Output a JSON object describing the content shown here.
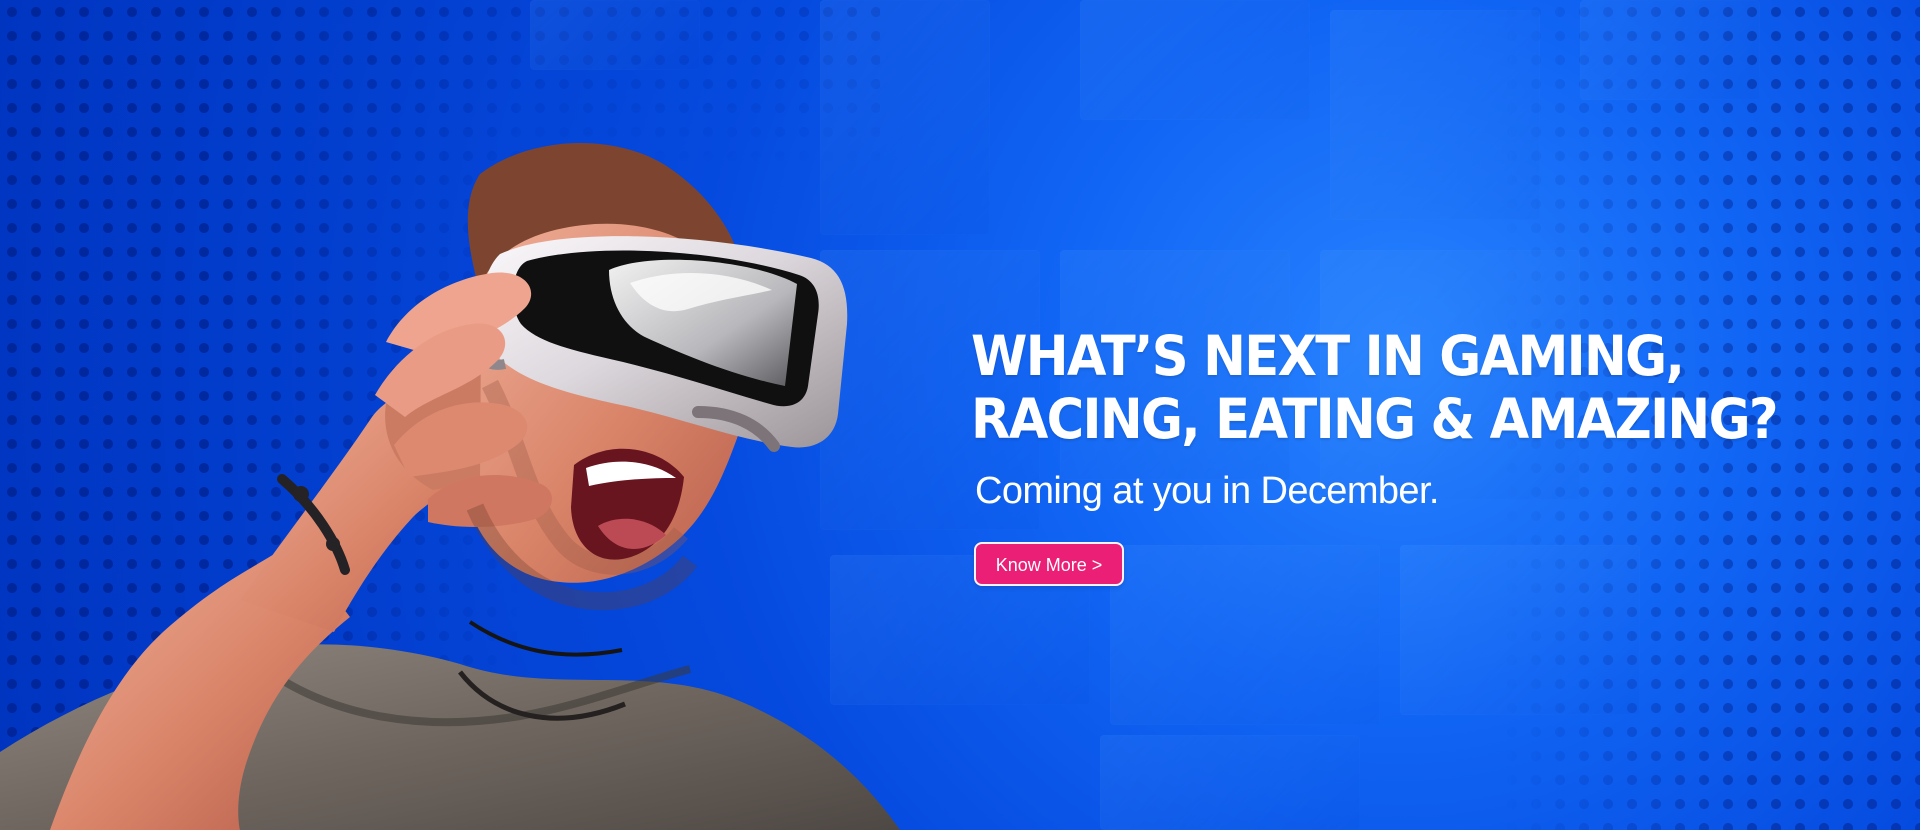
{
  "banner": {
    "headline_line_1": "WHAT’S NEXT IN GAMING,",
    "headline_line_2": "RACING, EATING & AMAZING?",
    "subheadline": "Coming at you in December.",
    "cta_label": "Know More >"
  },
  "colors": {
    "background_blue": "#0b5be7",
    "cta_pink": "#ea1f75",
    "text_white": "#ffffff",
    "shirt_gray": "#6f665f",
    "headset_white": "#ddd8dd",
    "skin_tone": "#d88b70"
  },
  "visual_elements": {
    "person": "vr-user",
    "headset": "vr-headset-icon",
    "background_texture": "halftone-pattern"
  }
}
